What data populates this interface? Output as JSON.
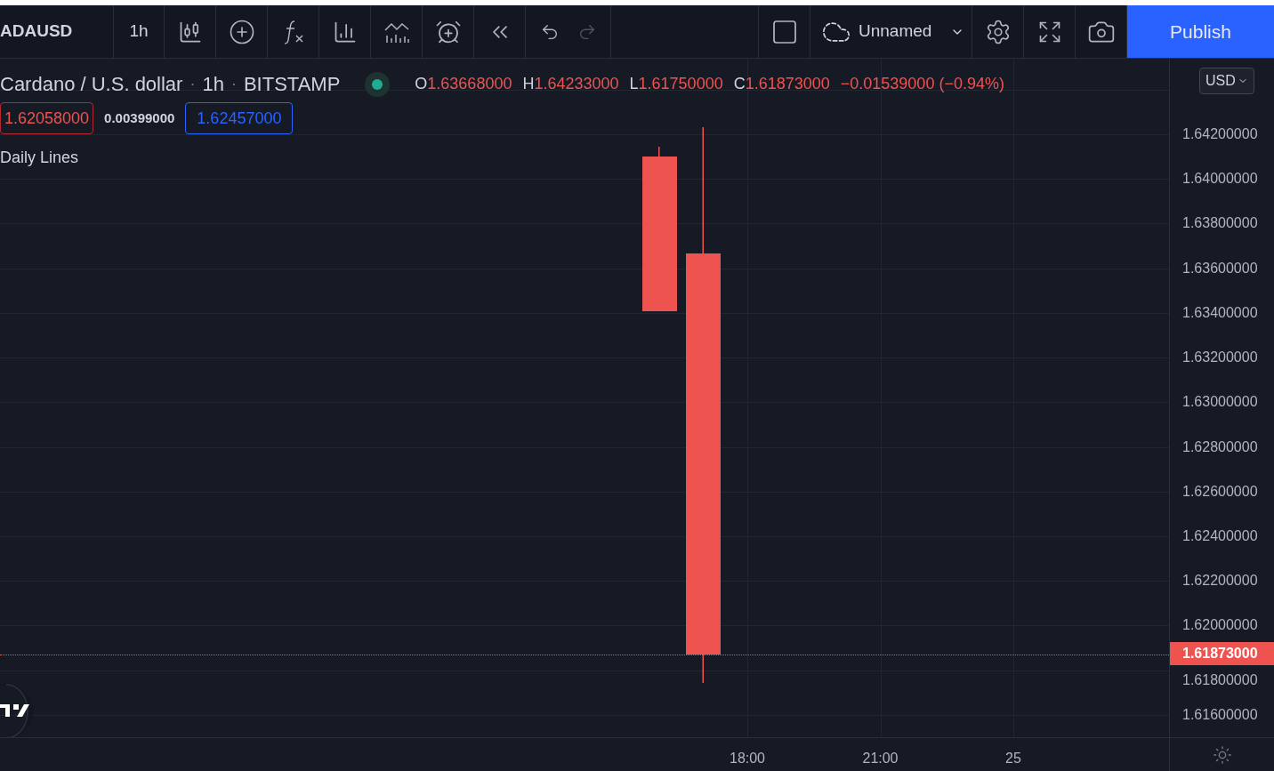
{
  "toolbar": {
    "symbol": "ADAUSD",
    "interval": "1h",
    "layout_name": "Unnamed",
    "publish": "Publish",
    "redo_disabled": true
  },
  "legend": {
    "title": "Cardano / U.S. dollar",
    "separator_1": "·",
    "interval": "1h",
    "separator_2": "·",
    "exchange": "BITSTAMP",
    "ohlc": [
      {
        "label": "O",
        "value": "1.63668000"
      },
      {
        "label": "H",
        "value": "1.64233000"
      },
      {
        "label": "L",
        "value": "1.61750000"
      },
      {
        "label": "C",
        "value": "1.61873000"
      }
    ],
    "change": "−0.01539000 (−0.94%)",
    "sell_price": "1.62058000",
    "spread": "0.00399000",
    "buy_price": "1.62457000",
    "indicator": "Daily Lines"
  },
  "price_axis": {
    "currency": "USD",
    "labels": [
      "1.64200000",
      "1.64000000",
      "1.63800000",
      "1.63600000",
      "1.63400000",
      "1.63200000",
      "1.63000000",
      "1.62800000",
      "1.62600000",
      "1.62400000",
      "1.62200000",
      "1.62000000",
      "1.61800000",
      "1.61600000"
    ],
    "current_price": "1.61873000"
  },
  "time_axis": {
    "labels": [
      "18:00",
      "21:00",
      "25"
    ]
  }
}
